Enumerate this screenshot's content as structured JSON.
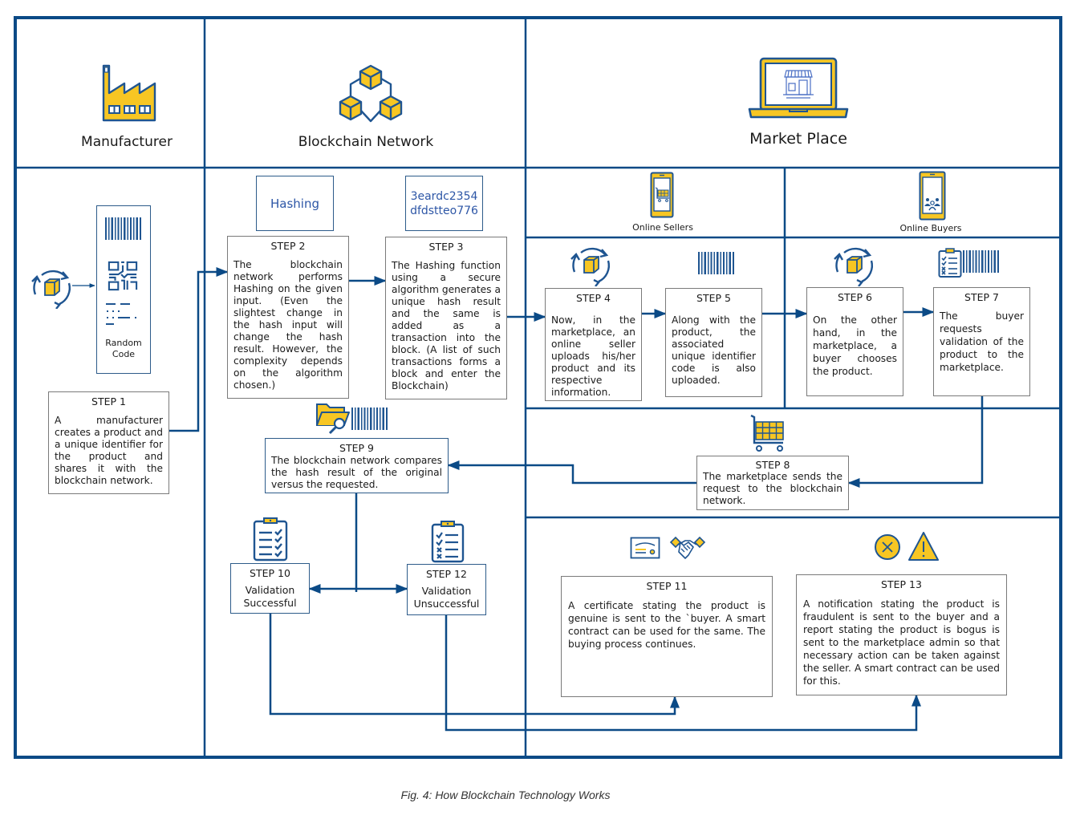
{
  "colors": {
    "frame": "#0b4a86",
    "accent_yellow": "#f7c623",
    "icon_blue": "#1f5591",
    "box_border": "#7a7a7a",
    "hash_text": "#2d56a6"
  },
  "columns": {
    "manufacturer": {
      "title": "Manufacturer",
      "icon": "factory-icon"
    },
    "blockchain": {
      "title": "Blockchain Network",
      "icon": "blockchain-cubes-icon"
    },
    "marketplace": {
      "title": "Market Place",
      "icon": "laptop-store-icon"
    }
  },
  "subcolumns": {
    "sellers": {
      "title": "Online Sellers",
      "icon": "phone-cart-icon"
    },
    "buyers": {
      "title": "Online Buyers",
      "icon": "phone-users-icon"
    }
  },
  "random_code": {
    "label_line1": "Random",
    "label_line2": "Code"
  },
  "hashing_label": "Hashing",
  "hash_value": {
    "line1": "3eardc2354",
    "line2": "dfdstteo776"
  },
  "steps": {
    "s1": {
      "title": "STEP 1",
      "text": "A manufacturer creates a product and a unique identifier for the product and shares it with the blockchain network."
    },
    "s2": {
      "title": "STEP 2",
      "text": "The blockchain network performs Hashing on the given input. (Even the slightest change in the hash input will change the hash result. However, the complexity depends on the algorithm chosen.)"
    },
    "s3": {
      "title": "STEP 3",
      "text": "The Hashing function using a secure algorithm generates a unique hash result and the same is added as a transaction into the block. (A list of such transactions forms a block and enter the Blockchain)"
    },
    "s4": {
      "title": "STEP 4",
      "text": "Now, in the marketplace, an online seller uploads his/her product and its respective information."
    },
    "s5": {
      "title": "STEP 5",
      "text": "Along with the product, the associated unique identifier code is also uploaded."
    },
    "s6": {
      "title": "STEP 6",
      "text": "On the other hand, in the marketplace, a buyer chooses the product."
    },
    "s7": {
      "title": "STEP 7",
      "text": "The buyer requests validation of the product to the marketplace."
    },
    "s8": {
      "title": "STEP 8",
      "text": "The marketplace sends the request to the blockchain network."
    },
    "s9": {
      "title": "STEP 9",
      "text": "The blockchain network compares the hash result of the original versus the requested."
    },
    "s10": {
      "title": "STEP 10",
      "text": "Validation Successful"
    },
    "s11": {
      "title": "STEP 11",
      "text": "A certificate stating the product is genuine is sent to the `buyer. A smart contract can be used for the same. The buying process continues."
    },
    "s12": {
      "title": "STEP 12",
      "text": "Validation Unsuccessful"
    },
    "s13": {
      "title": "STEP 13",
      "text": "A notification stating the product is fraudulent is sent to the buyer and a report stating the product is bogus is sent to the marketplace admin so that necessary action can be taken against the seller. A smart contract can be used for this."
    }
  },
  "caption": "Fig. 4: How Blockchain Technology Works"
}
